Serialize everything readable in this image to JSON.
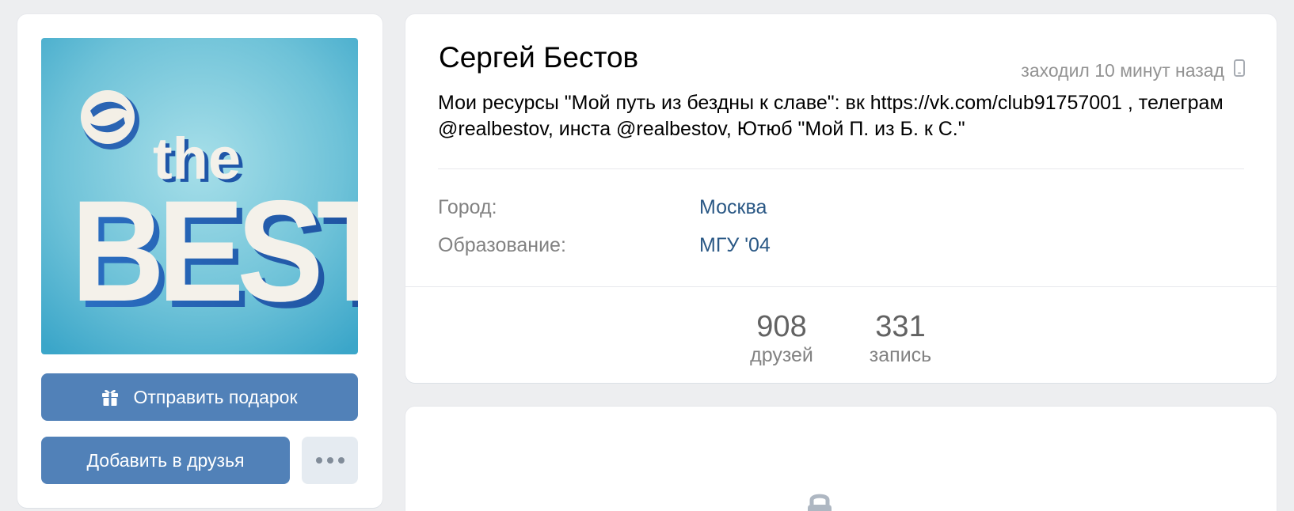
{
  "profile": {
    "name": "Сергей Бестов",
    "last_seen": "заходил 10 минут назад",
    "bio": "Мои ресурсы \"Мой путь из бездны к славе\": вк https://vk.com/club91757001 , телеграм @realbestov, инста @realbestov, Ютюб \"Мой П. из Б. к С.\"",
    "info": {
      "city_label": "Город:",
      "city_value": "Москва",
      "education_label": "Образование:",
      "education_value": "МГУ '04"
    },
    "counters": {
      "friends_count": "908",
      "friends_label": "друзей",
      "posts_count": "331",
      "posts_label": "запись"
    }
  },
  "avatar": {
    "text_small": "the",
    "text_big": "BEST"
  },
  "actions": {
    "gift_label": "Отправить подарок",
    "add_friend_label": "Добавить в друзья"
  },
  "icons": {
    "gift": "gift-icon",
    "more": "more-dots-icon",
    "mobile": "mobile-phone-icon",
    "lock": "lock-icon"
  },
  "colors": {
    "primary_button": "#5181b8",
    "secondary_button": "#e5ebf1",
    "link": "#2a5885",
    "page_bg": "#edeef0"
  }
}
